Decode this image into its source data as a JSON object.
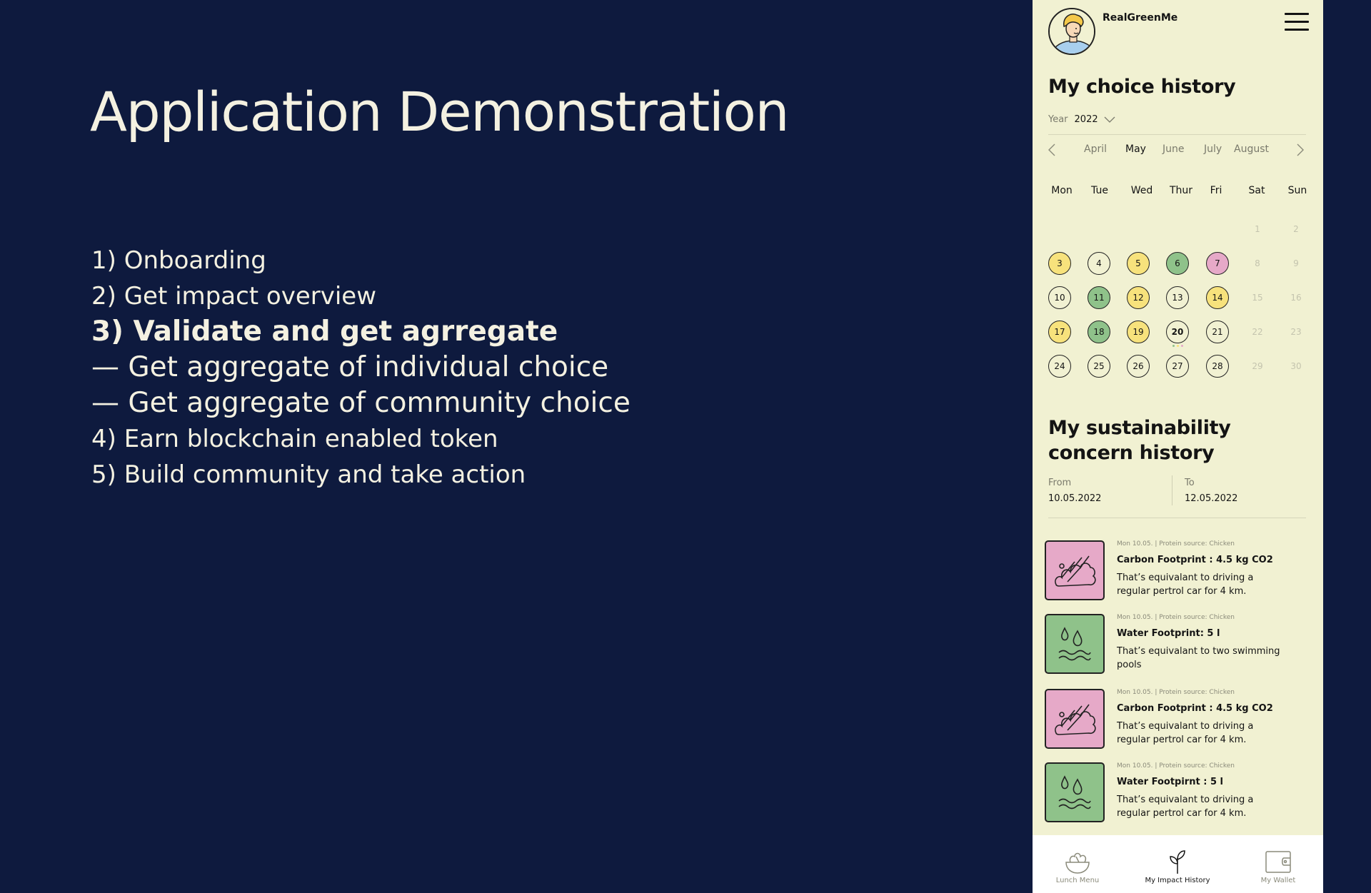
{
  "slide": {
    "title": "Application Demonstration",
    "agenda": [
      "1) Onboarding",
      "2) Get impact overview",
      "3) Validate and get agrregate",
      "— Get aggregate of individual choice",
      "— Get aggregate of community choice",
      "4) Earn blockchain enabled token",
      "5) Build community and take action"
    ]
  },
  "app": {
    "username": "RealGreenMe",
    "choice_history": {
      "title": "My choice history",
      "year_label": "Year",
      "year_value": "2022",
      "months": [
        "April",
        "May",
        "June",
        "July",
        "August"
      ],
      "active_month": "May",
      "weekdays": [
        "Mon",
        "Tue",
        "Wed",
        "Thur",
        "Fri",
        "Sat",
        "Sun"
      ],
      "days": [
        {
          "n": "1",
          "s": "muted"
        },
        {
          "n": "2",
          "s": "muted"
        },
        {
          "n": "3",
          "s": "y"
        },
        {
          "n": "4",
          "s": "w"
        },
        {
          "n": "5",
          "s": "y"
        },
        {
          "n": "6",
          "s": "g"
        },
        {
          "n": "7",
          "s": "p"
        },
        {
          "n": "8",
          "s": "muted"
        },
        {
          "n": "9",
          "s": "muted"
        },
        {
          "n": "10",
          "s": "w"
        },
        {
          "n": "11",
          "s": "g"
        },
        {
          "n": "12",
          "s": "y"
        },
        {
          "n": "13",
          "s": "w"
        },
        {
          "n": "14",
          "s": "y"
        },
        {
          "n": "15",
          "s": "muted"
        },
        {
          "n": "16",
          "s": "muted"
        },
        {
          "n": "17",
          "s": "y"
        },
        {
          "n": "18",
          "s": "g"
        },
        {
          "n": "19",
          "s": "y"
        },
        {
          "n": "20",
          "s": "today"
        },
        {
          "n": "21",
          "s": "w"
        },
        {
          "n": "22",
          "s": "muted"
        },
        {
          "n": "23",
          "s": "muted"
        },
        {
          "n": "24",
          "s": "w"
        },
        {
          "n": "25",
          "s": "w"
        },
        {
          "n": "26",
          "s": "w"
        },
        {
          "n": "27",
          "s": "w"
        },
        {
          "n": "28",
          "s": "w"
        },
        {
          "n": "29",
          "s": "muted"
        },
        {
          "n": "30",
          "s": "muted"
        }
      ]
    },
    "concern_history": {
      "title_line1": "My sustainability",
      "title_line2": "concern history",
      "from_label": "From",
      "from_value": "10.05.2022",
      "to_label": "To",
      "to_value": "12.05.2022",
      "cards": [
        {
          "kind": "carbon",
          "meta": "Mon 10.05. | Protein source: Chicken",
          "title": "Carbon Footprint : 4.5 kg CO2",
          "desc": "That’s equivalant to driving a regular pertrol car for 4 km."
        },
        {
          "kind": "water",
          "meta": "Mon 10.05. | Protein source: Chicken",
          "title": "Water Footprint: 5 l",
          "desc": "That’s equivalant to two swimming pools"
        },
        {
          "kind": "carbon",
          "meta": "Mon 10.05. | Protein source: Chicken",
          "title": "Carbon Footprint : 4.5 kg CO2",
          "desc": "That’s equivalant to driving a regular pertrol car for 4 km."
        },
        {
          "kind": "water",
          "meta": "Mon 10.05. | Protein source: Chicken",
          "title": "Water Footpirnt : 5 l",
          "desc": "That’s equivalant to driving a regular pertrol car for 4 km."
        }
      ]
    },
    "nav": [
      {
        "label": "Lunch Menu",
        "icon": "salad-bowl-icon"
      },
      {
        "label": "My Impact History",
        "icon": "sprout-icon"
      },
      {
        "label": "My Wallet",
        "icon": "wallet-icon"
      }
    ],
    "active_nav": "My Impact History",
    "colors": {
      "background": "#0e1a3e",
      "text_light": "#f4f1e1",
      "phone_bg": "#f1f1d2",
      "yellow": "#f7e27c",
      "green": "#8fc28a",
      "pink": "#e6a9c8"
    }
  }
}
